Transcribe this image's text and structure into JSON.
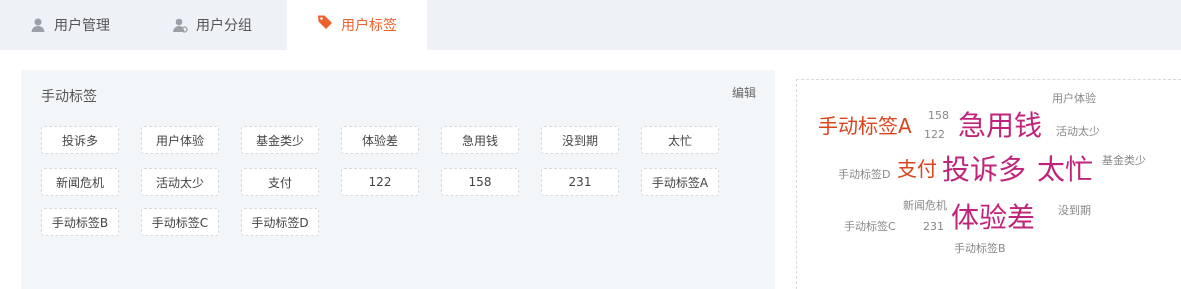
{
  "tabs": [
    {
      "label": "用户管理",
      "icon": "user-icon"
    },
    {
      "label": "用户分组",
      "icon": "user-group-icon"
    },
    {
      "label": "用户标签",
      "icon": "tag-icon"
    }
  ],
  "active_tab": "用户标签",
  "colors": {
    "accent": "#f0602c",
    "cloud_magenta": "#c0247a",
    "cloud_orange": "#d9451c",
    "cloud_gray": "#888888"
  },
  "manual_tags": {
    "title": "手动标签",
    "edit_label": "编辑",
    "tags": [
      "投诉多",
      "用户体验",
      "基金类少",
      "体验差",
      "急用钱",
      "没到期",
      "太忙",
      "新闻危机",
      "活动太少",
      "支付",
      "122",
      "158",
      "231",
      "手动标签A",
      "手动标签B",
      "手动标签C",
      "手动标签D"
    ]
  },
  "word_cloud": {
    "words": [
      {
        "text": "用户体验",
        "weight": 1
      },
      {
        "text": "158",
        "weight": 1
      },
      {
        "text": "手动标签A",
        "weight": 2
      },
      {
        "text": "急用钱",
        "weight": 3
      },
      {
        "text": "122",
        "weight": 1
      },
      {
        "text": "活动太少",
        "weight": 1
      },
      {
        "text": "手动标签D",
        "weight": 1
      },
      {
        "text": "支付",
        "weight": 2
      },
      {
        "text": "投诉多",
        "weight": 3
      },
      {
        "text": "太忙",
        "weight": 3
      },
      {
        "text": "基金类少",
        "weight": 1
      },
      {
        "text": "新闻危机",
        "weight": 1
      },
      {
        "text": "体验差",
        "weight": 3
      },
      {
        "text": "没到期",
        "weight": 1
      },
      {
        "text": "手动标签C",
        "weight": 1
      },
      {
        "text": "231",
        "weight": 1
      },
      {
        "text": "手动标签B",
        "weight": 1
      }
    ]
  }
}
